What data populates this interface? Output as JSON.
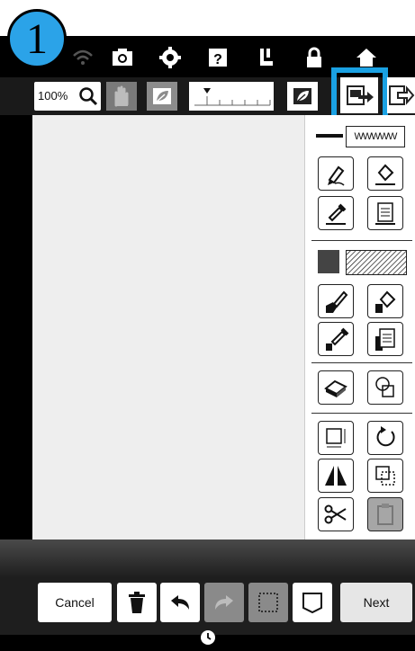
{
  "step_badge": "1",
  "status_icons": [
    "wifi-icon",
    "camera-icon",
    "settings-icon",
    "help-icon",
    "sewing-foot-icon",
    "lock-icon",
    "home-icon"
  ],
  "toolbar": {
    "zoom_label": "100%",
    "icons": [
      "zoom-icon",
      "hand-icon",
      "leaf-icon",
      "density-slider",
      "leaf-icon",
      "export-icon",
      "export-alt-icon"
    ]
  },
  "panel": {
    "line_pattern_label": "WWWWW",
    "tools": [
      "line-pen-icon",
      "line-fill-icon",
      "line-dropper-icon",
      "line-properties-icon",
      "region-brush-icon",
      "region-fill-icon",
      "region-dropper-icon",
      "region-properties-icon",
      "eraser-icon",
      "shapes-icon",
      "resize-icon",
      "rotate-icon",
      "flip-icon",
      "duplicate-icon",
      "cut-icon",
      "paste-icon"
    ]
  },
  "bottom": {
    "cancel_label": "Cancel",
    "next_label": "Next"
  },
  "colors": {
    "highlight": "#1aa1e3",
    "badge": "#2ba3e8",
    "canvas": "#eeeeee"
  }
}
